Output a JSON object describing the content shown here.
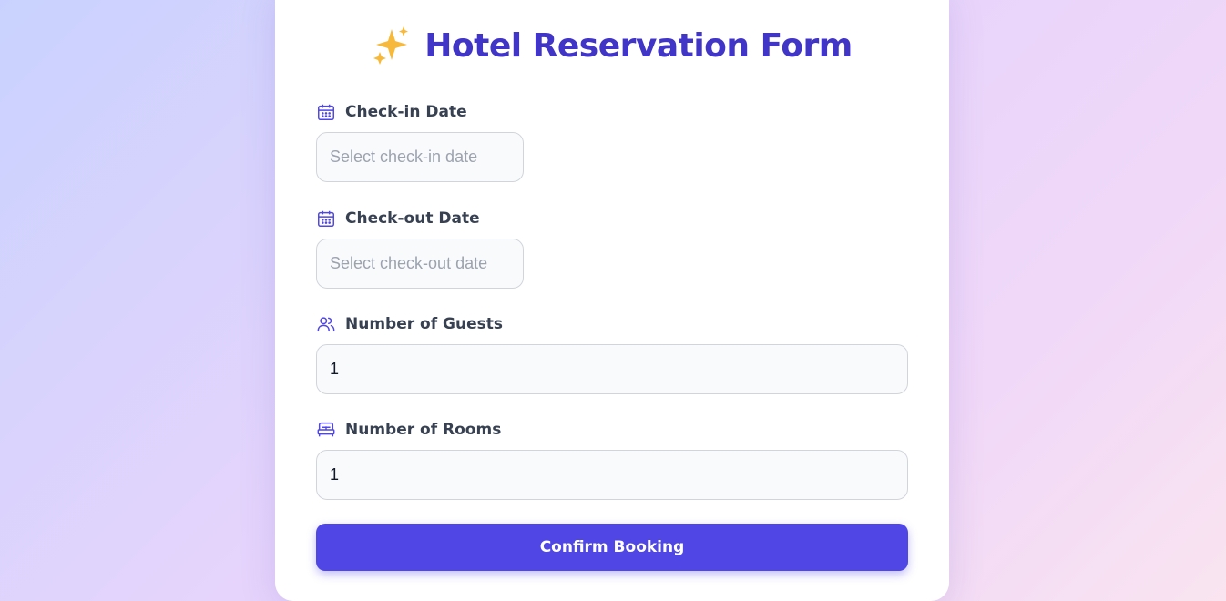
{
  "form": {
    "title": "Hotel Reservation Form",
    "title_icon": "sparkles-icon",
    "accent_color": "#4f46e5",
    "title_color": "#4035c6",
    "fields": {
      "checkin": {
        "label": "Check-in Date",
        "icon": "calendar-icon",
        "value": "",
        "placeholder": "Select check-in date"
      },
      "checkout": {
        "label": "Check-out Date",
        "icon": "calendar-icon",
        "value": "",
        "placeholder": "Select check-out date"
      },
      "guests": {
        "label": "Number of Guests",
        "icon": "users-icon",
        "value": "1",
        "placeholder": ""
      },
      "rooms": {
        "label": "Number of Rooms",
        "icon": "bed-icon",
        "value": "1",
        "placeholder": ""
      }
    },
    "submit_label": "Confirm Booking"
  }
}
